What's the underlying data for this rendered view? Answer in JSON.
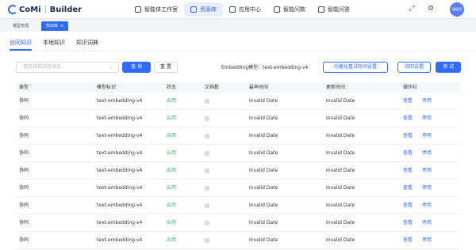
{
  "header": {
    "logo_text": "CoMi",
    "logo_sub": "Builder",
    "nav": [
      {
        "label": "智能体工作室",
        "icon": "robot-icon",
        "active": false
      },
      {
        "label": "资源库",
        "icon": "folder-icon",
        "active": true
      },
      {
        "label": "应用中心",
        "icon": "grid-icon",
        "active": false
      },
      {
        "label": "智能问数",
        "icon": "chart-icon",
        "active": false
      },
      {
        "label": "智能问答",
        "icon": "chat-icon",
        "active": false
      }
    ],
    "avatar_text": "超级用"
  },
  "tabstrip": {
    "tabs": [
      {
        "label": "模型管理"
      },
      {
        "label": "知识库",
        "close": "×"
      }
    ]
  },
  "subtabs": [
    {
      "label": "协同知识",
      "active": true
    },
    {
      "label": "本地知识",
      "active": false
    },
    {
      "label": "知识词典",
      "active": false
    }
  ],
  "toolbar": {
    "filter_placeholder": "请选择知识库状态",
    "search_label": "查 询",
    "reset_label": "重 置",
    "embedding_label": "Embedding模型：text-embedding-v4",
    "schedule_label": "向量化重试时间设置",
    "recall_label": "召回设置",
    "test_label": "测 试"
  },
  "table": {
    "headers": [
      "类型",
      "模型标识",
      "状态",
      "文档数",
      "最早时间",
      "更新时间",
      "操作栏"
    ],
    "rows": [
      {
        "type": "协同",
        "model": "text-embedding-v4",
        "status": "启用",
        "earliest": "Invalid Date",
        "updated": "Invalid Date",
        "view": "查看",
        "disable": "停用"
      },
      {
        "type": "协同",
        "model": "text-embedding-v4",
        "status": "启用",
        "earliest": "Invalid Date",
        "updated": "Invalid Date",
        "view": "查看",
        "disable": "停用"
      },
      {
        "type": "协同",
        "model": "text-embedding-v4",
        "status": "启用",
        "earliest": "Invalid Date",
        "updated": "Invalid Date",
        "view": "查看",
        "disable": "停用"
      },
      {
        "type": "协同",
        "model": "text-embedding-v4",
        "status": "启用",
        "earliest": "Invalid Date",
        "updated": "Invalid Date",
        "view": "查看",
        "disable": "停用"
      },
      {
        "type": "协同",
        "model": "text-embedding-v4",
        "status": "启用",
        "earliest": "Invalid Date",
        "updated": "Invalid Date",
        "view": "查看",
        "disable": "停用"
      },
      {
        "type": "协同",
        "model": "text-embedding-v4",
        "status": "启用",
        "earliest": "Invalid Date",
        "updated": "Invalid Date",
        "view": "查看",
        "disable": "停用"
      },
      {
        "type": "协同",
        "model": "text-embedding-v4",
        "status": "启用",
        "earliest": "Invalid Date",
        "updated": "Invalid Date",
        "view": "查看",
        "disable": "停用"
      },
      {
        "type": "协同",
        "model": "text-embedding-v4",
        "status": "启用",
        "earliest": "Invalid Date",
        "updated": "Invalid Date",
        "view": "查看",
        "disable": "停用"
      },
      {
        "type": "协同",
        "model": "text-embedding-v4",
        "status": "启用",
        "earliest": "Invalid Date",
        "updated": "Invalid Date",
        "view": "查看",
        "disable": "停用"
      }
    ]
  },
  "colors": {
    "accent": "#2f6bff",
    "status_enabled": "#3bbf6a"
  }
}
